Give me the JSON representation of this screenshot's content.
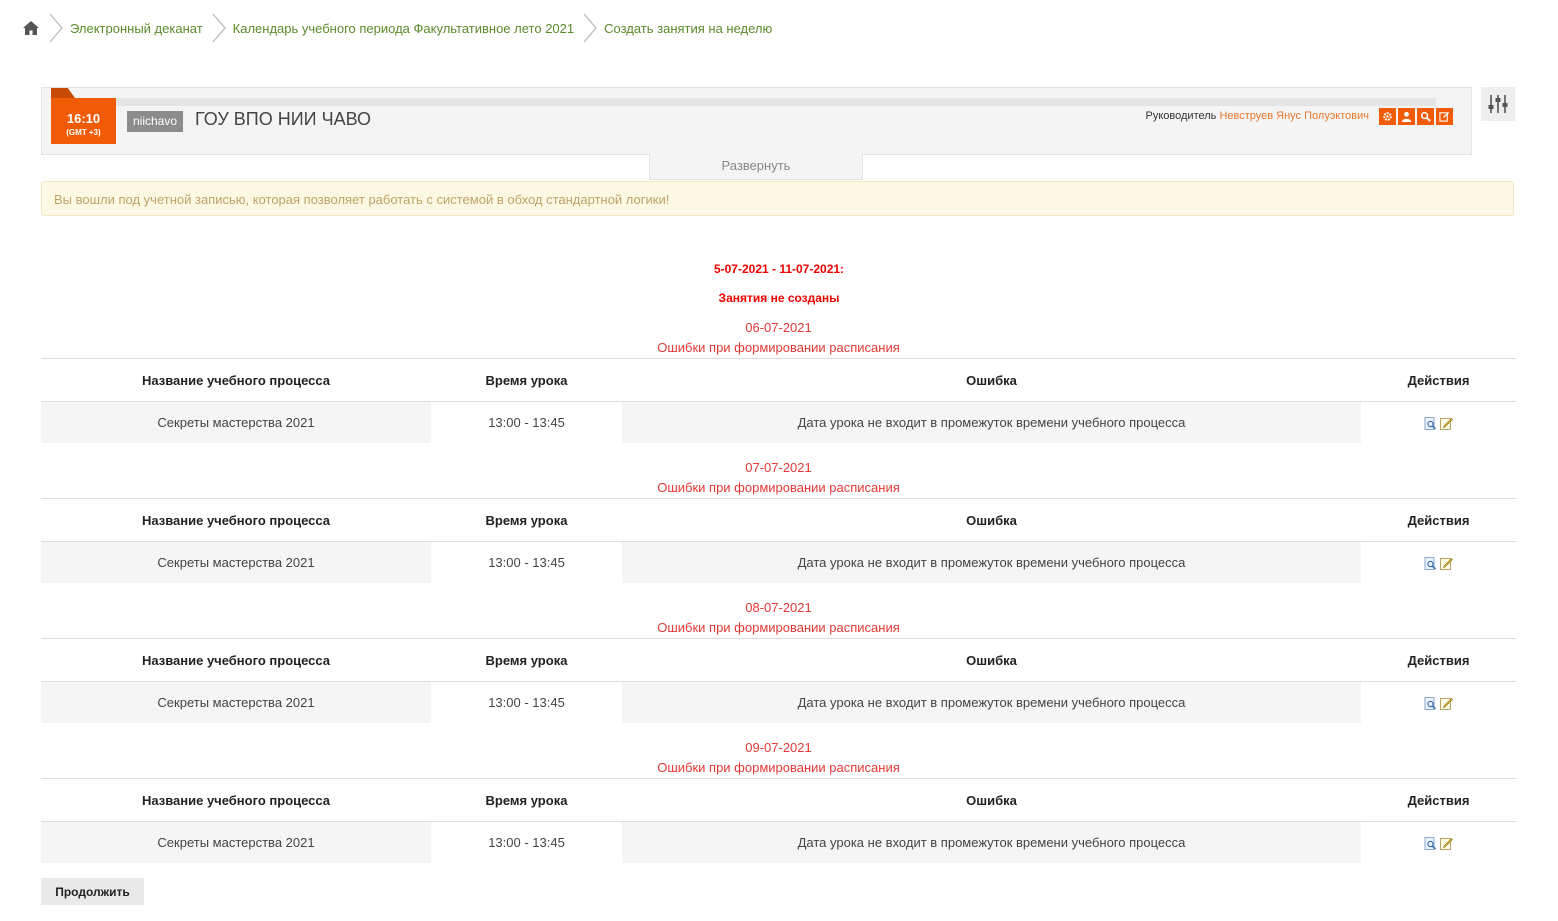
{
  "breadcrumb": {
    "home_icon": "home-icon",
    "items": [
      {
        "label": "Электронный деканат"
      },
      {
        "label": "Календарь учебного периода Факультативное лето 2021"
      },
      {
        "label": "Создать занятия на неделю"
      }
    ]
  },
  "header": {
    "clock_time": "16:10",
    "clock_tz": "(GMT +3)",
    "login": "niichavo",
    "org_name": "ГОУ ВПО НИИ ЧАВО",
    "manager_label": "Руководитель",
    "manager_name": "Невструев Янус Полуэктович",
    "buttons": [
      "gear-icon",
      "user-icon",
      "search-icon",
      "edit-icon"
    ],
    "expand_label": "Развернуть"
  },
  "alert": {
    "text": "Вы вошли под учетной записью, которая позволяет работать с системой в обход стандартной логики!"
  },
  "period": {
    "range": "5-07-2021 - 11-07-2021:",
    "status": "Занятия не созданы"
  },
  "table_headers": {
    "name": "Название учебного процесса",
    "time": "Время урока",
    "error": "Ошибка",
    "actions": "Действия"
  },
  "days": [
    {
      "date": "06-07-2021",
      "error_title": "Ошибки при формировании расписания",
      "rows": [
        {
          "name": "Секреты мастерства 2021",
          "time": "13:00 - 13:45",
          "error": "Дата урока не входит в промежуток времени учебного процесса"
        }
      ]
    },
    {
      "date": "07-07-2021",
      "error_title": "Ошибки при формировании расписания",
      "rows": [
        {
          "name": "Секреты мастерства 2021",
          "time": "13:00 - 13:45",
          "error": "Дата урока не входит в промежуток времени учебного процесса"
        }
      ]
    },
    {
      "date": "08-07-2021",
      "error_title": "Ошибки при формировании расписания",
      "rows": [
        {
          "name": "Секреты мастерства 2021",
          "time": "13:00 - 13:45",
          "error": "Дата урока не входит в промежуток времени учебного процесса"
        }
      ]
    },
    {
      "date": "09-07-2021",
      "error_title": "Ошибки при формировании расписания",
      "rows": [
        {
          "name": "Секреты мастерства 2021",
          "time": "13:00 - 13:45",
          "error": "Дата урока не входит в промежуток времени учебного процесса"
        }
      ]
    }
  ],
  "colors": {
    "accent": "#f25b06",
    "link": "#5b8a2a",
    "error": "#e53935"
  },
  "continue_label": "Продолжить"
}
